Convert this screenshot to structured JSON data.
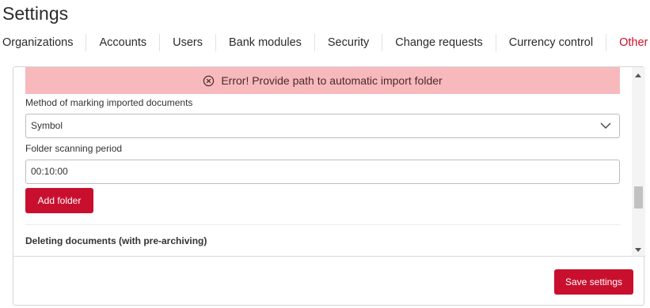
{
  "page": {
    "title": "Settings"
  },
  "tabs": [
    {
      "label": "Organizations"
    },
    {
      "label": "Accounts"
    },
    {
      "label": "Users"
    },
    {
      "label": "Bank modules"
    },
    {
      "label": "Security"
    },
    {
      "label": "Change requests"
    },
    {
      "label": "Currency control"
    },
    {
      "label": "Other",
      "active": true
    }
  ],
  "error": {
    "message": "Error! Provide path to automatic import folder",
    "icon": "circle-x-icon"
  },
  "form": {
    "marking_label": "Method of marking imported documents",
    "marking_value": "Symbol",
    "period_label": "Folder scanning period",
    "period_value": "00:10:00",
    "add_folder_label": "Add folder",
    "deleting_section_title": "Deleting documents (with pre-archiving)"
  },
  "footer": {
    "save_label": "Save settings"
  },
  "colors": {
    "accent": "#c8102e",
    "error_bg": "#f8b9bd"
  }
}
